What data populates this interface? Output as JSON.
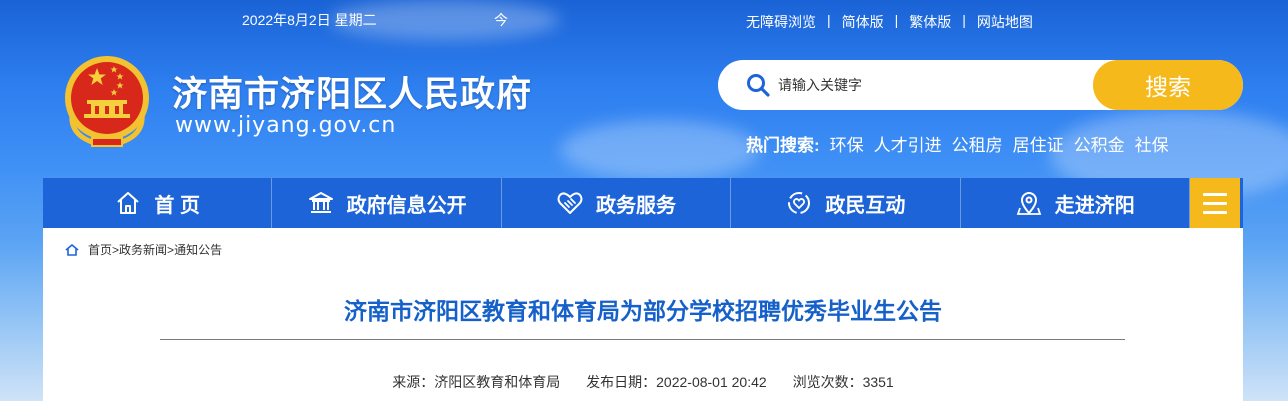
{
  "header": {
    "date": "2022年8月2日 星期二",
    "weather": "今",
    "top_links": [
      "无障碍浏览",
      "简体版",
      "繁体版",
      "网站地图"
    ],
    "site_title": "济南市济阳区人民政府",
    "site_url": "www.jiyang.gov.cn"
  },
  "search": {
    "placeholder": "请输入关键字",
    "button_label": "搜索"
  },
  "hot_search": {
    "label": "热门搜索:",
    "items": [
      "环保",
      "人才引进",
      "公租房",
      "居住证",
      "公积金",
      "社保"
    ]
  },
  "nav": {
    "items": [
      {
        "label": "首 页",
        "icon": "home-icon"
      },
      {
        "label": "政府信息公开",
        "icon": "government-building-icon"
      },
      {
        "label": "政务服务",
        "icon": "handshake-heart-icon"
      },
      {
        "label": "政民互动",
        "icon": "interaction-icon"
      },
      {
        "label": "走进济阳",
        "icon": "location-pin-icon"
      }
    ],
    "menu_icon": "hamburger-menu-icon"
  },
  "breadcrumb": {
    "items": [
      "首页",
      "政务新闻",
      "通知公告"
    ]
  },
  "article": {
    "title": "济南市济阳区教育和体育局为部分学校招聘优秀毕业生公告",
    "source": "来源：济阳区教育和体育局",
    "publish_date": "发布日期：2022-08-01 20:42",
    "views": "浏览次数：3351"
  },
  "colors": {
    "nav_blue": "#1d64d8",
    "accent_yellow": "#f5b91c",
    "title_blue": "#1661c9"
  }
}
